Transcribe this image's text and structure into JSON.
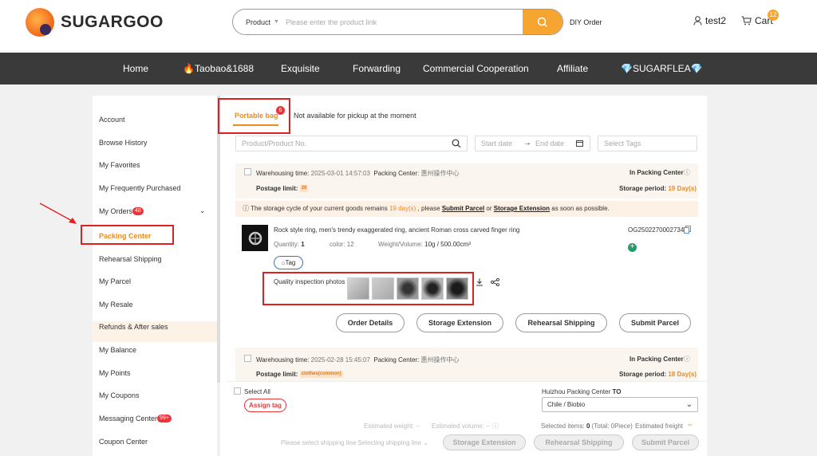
{
  "header": {
    "logo_text": "SUGARGOO",
    "search_type": "Product",
    "search_placeholder": "Please enter the product link",
    "diy_order": "DIY Order",
    "username": "test2",
    "cart_label": "Cart",
    "cart_count": "12"
  },
  "nav": [
    "Home",
    "Taobao&1688",
    "Exquisite",
    "Forwarding",
    "Commercial Cooperation",
    "Affiliate",
    "SUGARFLEA"
  ],
  "sidebar": {
    "items": [
      "Account",
      "Browse History",
      "My Favorites",
      "My Frequently Purchased",
      "My Orders",
      "Packing Center",
      "Rehearsal Shipping",
      "My Parcel",
      "My Resale",
      "Refunds & After sales",
      "My Balance",
      "My Points",
      "My Coupons",
      "Messaging Center",
      "Coupon Center"
    ],
    "orders_badge": "48",
    "messaging_badge": "99+",
    "active": "Packing Center"
  },
  "tabs": {
    "portable_bag": "Portable bag",
    "portable_bag_count": "6",
    "not_available": "Not available for pickup at the moment"
  },
  "filters": {
    "product_placeholder": "Product/Product No.",
    "start_date": "Start date",
    "end_date": "End date",
    "tags_placeholder": "Select Tags"
  },
  "card1": {
    "warehousing_label": "Warehousing time:",
    "warehousing_time": "2025-03-01 14:57:03",
    "packing_center_label": "Packing Center:",
    "packing_center": "惠州操作中心",
    "status": "In Packing Center",
    "postage_limit_label": "Postage limit:",
    "postage_limit_tag": "28",
    "storage_period_label": "Storage period:",
    "storage_period": "19 Day(s)",
    "notice_a": "The storage cycle of your current goods remains",
    "notice_days": "19 day(s)",
    "notice_b": ", please",
    "notice_submit": "Submit Parcel",
    "notice_or": "or",
    "notice_extension": "Storage Extension",
    "notice_c": "as soon as possible.",
    "product_title": "Rock style ring, men's trendy exaggerated ring, ancient Roman cross carved finger ring",
    "quantity_label": "Quantity:",
    "quantity": "1",
    "color_label": "color:",
    "color": "12",
    "weight_label": "Weight/Volume:",
    "weight": "10g / 500.00cm³",
    "order_no": "OG2502270002734",
    "tag_button": "Tag",
    "qi_label": "Quality inspection photos",
    "buttons": [
      "Order Details",
      "Storage Extension",
      "Rehearsal Shipping",
      "Submit Parcel"
    ]
  },
  "card2": {
    "warehousing_label": "Warehousing time:",
    "warehousing_time": "2025-02-28 15:45:07",
    "packing_center_label": "Packing Center:",
    "packing_center": "惠州操作中心",
    "status": "In Packing Center",
    "postage_limit_label": "Postage limit:",
    "postage_limit_tag": "clothes(common)",
    "storage_period_label": "Storage period:",
    "storage_period": "18 Day(s)"
  },
  "bottom": {
    "select_all": "Select All",
    "assign_tag": "Assign tag",
    "packing_center_name": "Huizhou Packing Center",
    "to_label": "TO",
    "destination": "Chile / Biobio",
    "est_weight": "Estimated weight: --",
    "est_volume": "Estimated volume: --",
    "selected_items": "Selected items:",
    "selected_count": "0",
    "selected_total": "(Total: 0Piece)",
    "est_freight": "Estimated freight",
    "freight_value": "--",
    "shipping_line_hint": "Please select shipping line",
    "selecting_line": "Selecting shipping line",
    "buttons": [
      "Storage Extension",
      "Rehearsal Shipping",
      "Submit Parcel"
    ]
  },
  "colors": {
    "accent": "#f7a531",
    "nav_bg": "#3a3a3a",
    "highlight_box": "#e02020",
    "active_text": "#f08a1c"
  }
}
